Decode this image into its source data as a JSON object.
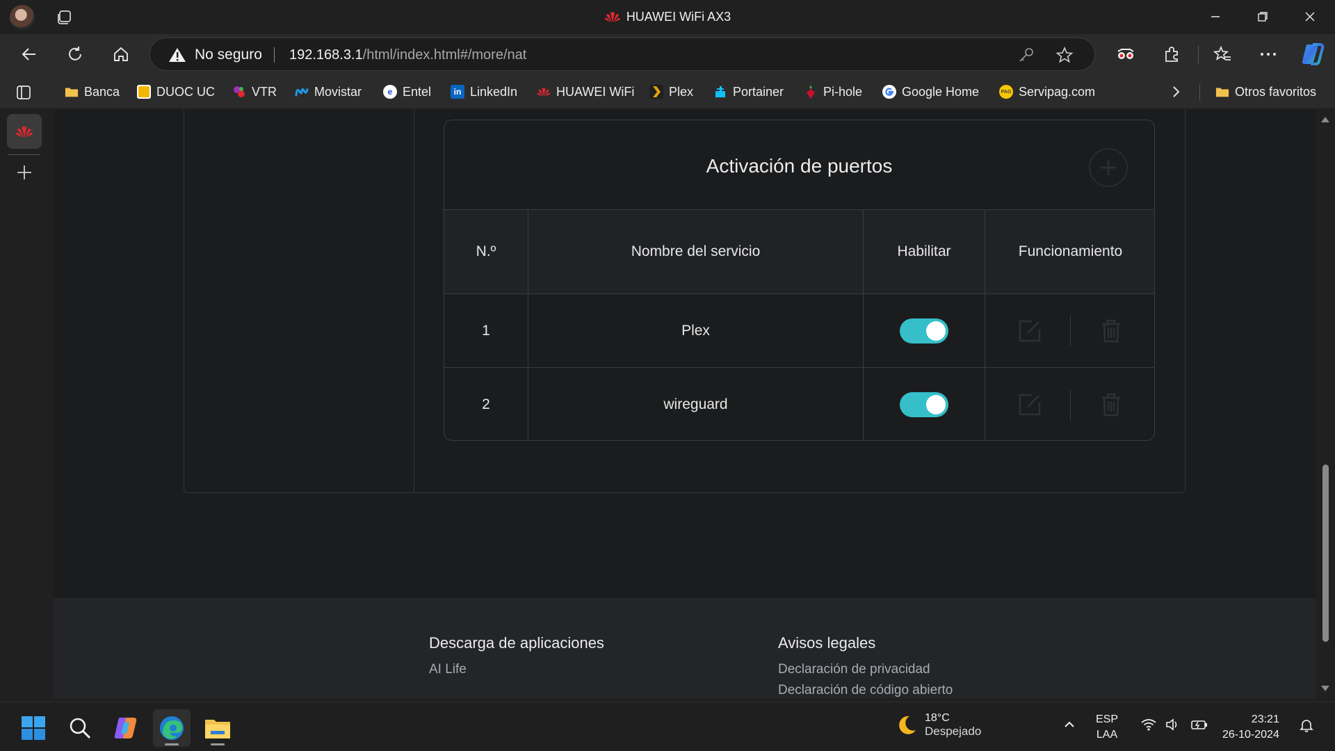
{
  "window": {
    "title": "HUAWEI WiFi AX3"
  },
  "address_bar": {
    "security_label": "No seguro",
    "url_host": "192.168.3.1",
    "url_path": "/html/index.html#/more/nat"
  },
  "bookmarks": [
    {
      "label": "Banca",
      "icon": "folder-icon"
    },
    {
      "label": "DUOC UC",
      "icon": "duoc-icon"
    },
    {
      "label": "VTR",
      "icon": "vtr-icon"
    },
    {
      "label": "Movistar",
      "icon": "movistar-icon"
    },
    {
      "label": "Entel",
      "icon": "entel-icon"
    },
    {
      "label": "LinkedIn",
      "icon": "linkedin-icon"
    },
    {
      "label": "HUAWEI WiFi",
      "icon": "huawei-icon"
    },
    {
      "label": "Plex",
      "icon": "plex-icon"
    },
    {
      "label": "Portainer",
      "icon": "portainer-icon"
    },
    {
      "label": "Pi-hole",
      "icon": "pihole-icon"
    },
    {
      "label": "Google Home",
      "icon": "google-icon"
    },
    {
      "label": "Servipag.com",
      "icon": "servipag-icon"
    }
  ],
  "bookmarks_other": "Otros favoritos",
  "panel": {
    "title": "Activación de puertos",
    "columns": [
      "N.º",
      "Nombre del servicio",
      "Habilitar",
      "Funcionamiento"
    ],
    "rows": [
      {
        "num": "1",
        "name": "Plex",
        "enabled": true
      },
      {
        "num": "2",
        "name": "wireguard",
        "enabled": true
      }
    ]
  },
  "footer": {
    "apps_heading": "Descarga de aplicaciones",
    "apps_link": "AI Life",
    "legal_heading": "Avisos legales",
    "legal_links": [
      "Declaración de privacidad",
      "Declaración de código abierto"
    ]
  },
  "taskbar": {
    "weather_temp": "18°C",
    "weather_desc": "Despejado",
    "lang_top": "ESP",
    "lang_bottom": "LAA",
    "time": "23:21",
    "date": "26-10-2024"
  },
  "colors": {
    "toggle_on": "#36bfc8",
    "huawei_red": "#e0262f",
    "edge_accent": "#2ea6e0"
  }
}
